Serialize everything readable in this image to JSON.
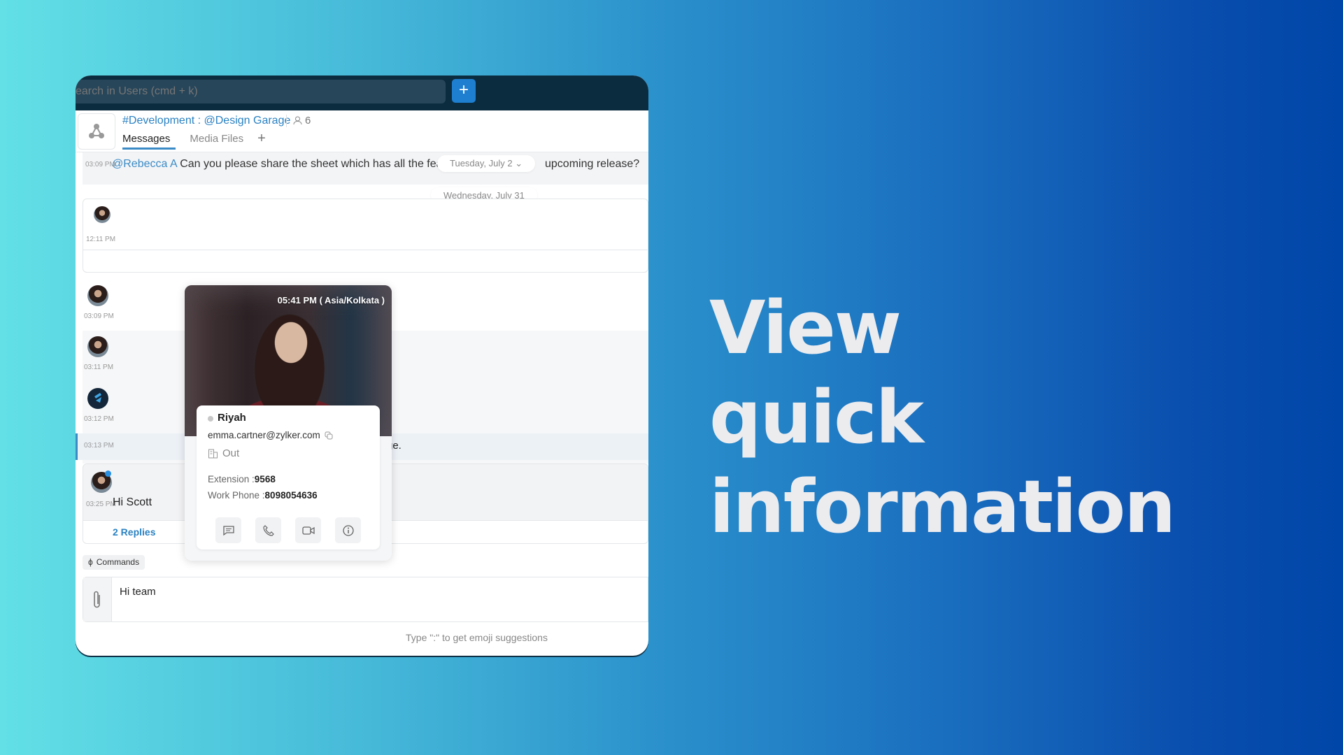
{
  "colors": {
    "accent": "#2b82c3",
    "topbar": "#0b2c3e",
    "plus_button": "#1e7fd1",
    "headline": "#ececef",
    "bg_gradient_start": "#62e0e6",
    "bg_gradient_end": "#0046a8"
  },
  "headline": {
    "line1": "View",
    "line2": "quick information"
  },
  "topbar": {
    "search_placeholder": "earch in Users (cmd + k)",
    "add_button_icon": "plus-icon",
    "add_button_label": "+"
  },
  "channel": {
    "title": "#Development : @Design Garage",
    "member_count": "6",
    "tabs": [
      {
        "label": "Messages",
        "active": true
      },
      {
        "label": "Media Files",
        "active": false
      }
    ],
    "add_tab_label": "+"
  },
  "messages": [
    {
      "time": "03:09 PM",
      "mention": "@Rebecca A",
      "text_before": " Can you please share the sheet which has all the feat",
      "text_after": "upcoming release?"
    },
    {
      "time": "12:11 PM"
    },
    {
      "time": "03:09 PM"
    },
    {
      "time": "03:11 PM"
    },
    {
      "time": "03:12 PM"
    },
    {
      "time": "03:13 PM",
      "text": "ge."
    },
    {
      "time": "03:25 PM",
      "text": "Hi Scott",
      "replies": "2 Replies"
    }
  ],
  "date_pills": [
    "Tuesday, July 2",
    "Wednesday, July 31"
  ],
  "popover": {
    "timezone": "05:41 PM ( Asia/Kolkata )",
    "name": "Riyah",
    "email": "emma.cartner@zylker.com",
    "status": "Out",
    "extension_label": "Extension :",
    "extension": "9568",
    "phone_label": "Work Phone :",
    "phone": "8098054636",
    "actions": [
      "chat-icon",
      "phone-icon",
      "video-icon",
      "info-icon"
    ]
  },
  "composer": {
    "commands_label": "Commands",
    "value": "Hi team",
    "emoji_hint": "Type \":\" to get emoji suggestions"
  }
}
